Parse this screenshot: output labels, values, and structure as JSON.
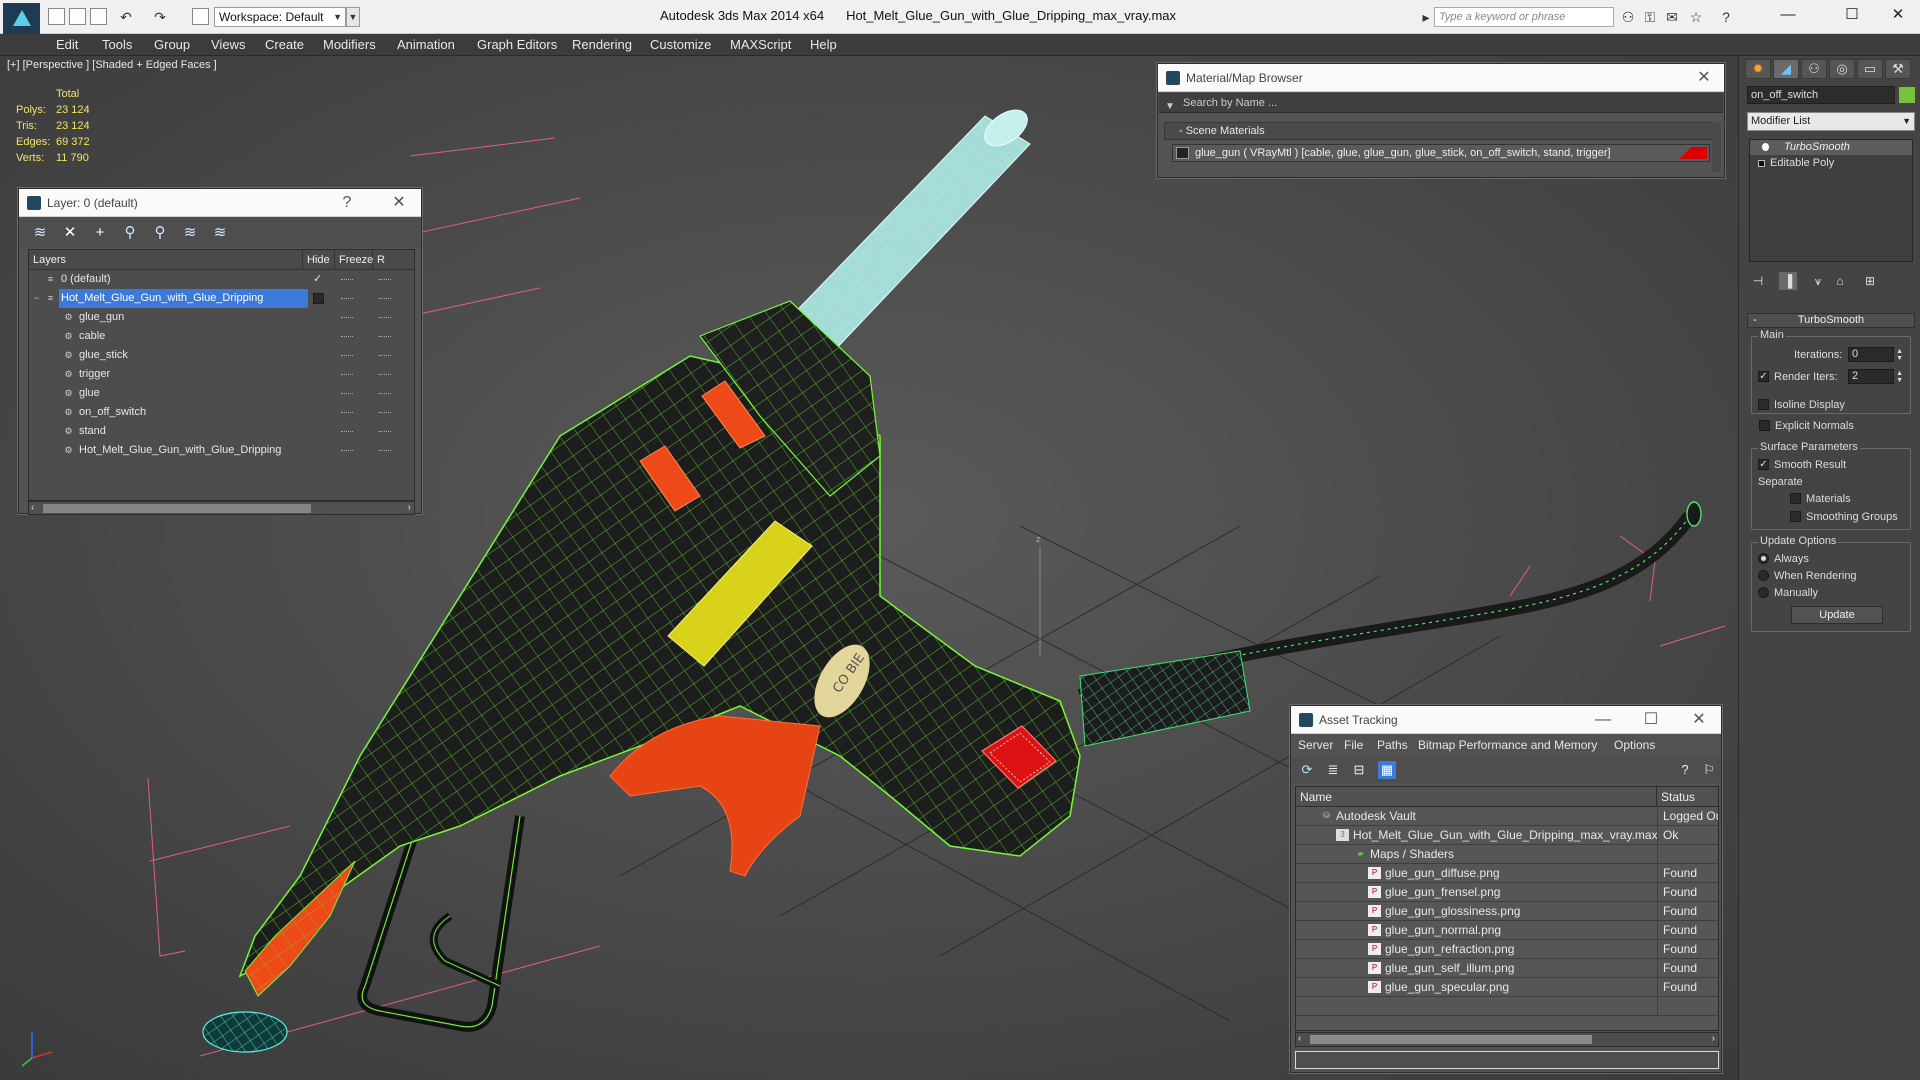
{
  "titlebar": {
    "workspace_label": "Workspace: Default",
    "app_name": "Autodesk 3ds Max  2014 x64",
    "file_name": "Hot_Melt_Glue_Gun_with_Glue_Dripping_max_vray.max",
    "search_placeholder": "Type a keyword or phrase"
  },
  "menu": [
    "Edit",
    "Tools",
    "Group",
    "Views",
    "Create",
    "Modifiers",
    "Animation",
    "Graph Editors",
    "Rendering",
    "Customize",
    "MAXScript",
    "Help"
  ],
  "viewport": {
    "label": "[+] [Perspective ] [Shaded + Edged Faces ]",
    "stats": {
      "header": "Total",
      "rows": [
        {
          "key": "Polys:",
          "value": "23 124"
        },
        {
          "key": "Tris:",
          "value": "23 124"
        },
        {
          "key": "Edges:",
          "value": "69 372"
        },
        {
          "key": "Verts:",
          "value": "11 790"
        }
      ]
    },
    "decal_text": "CO BIE"
  },
  "layers": {
    "title": "Layer: 0 (default)",
    "help": "?",
    "columns": {
      "name": "Layers",
      "hide": "Hide",
      "freeze": "Freeze",
      "render": "R"
    },
    "items": [
      {
        "name": "0 (default)",
        "check": "✓"
      },
      {
        "name": "Hot_Melt_Glue_Gun_with_Glue_Dripping"
      },
      {
        "name": "glue_gun"
      },
      {
        "name": "cable"
      },
      {
        "name": "glue_stick"
      },
      {
        "name": "trigger"
      },
      {
        "name": "glue"
      },
      {
        "name": "on_off_switch"
      },
      {
        "name": "stand"
      },
      {
        "name": "Hot_Melt_Glue_Gun_with_Glue_Dripping"
      }
    ]
  },
  "material_browser": {
    "title": "Material/Map Browser",
    "search_placeholder": "Search by Name ...",
    "section": "- Scene Materials",
    "material": "glue_gun  ( VRayMtl ) [cable, glue, glue_gun, glue_stick, on_off_switch, stand, trigger]"
  },
  "asset_tracking": {
    "title": "Asset Tracking",
    "menu": [
      "Server",
      "File",
      "Paths",
      "Bitmap Performance and Memory",
      "Options"
    ],
    "columns": {
      "name": "Name",
      "status": "Status"
    },
    "rows": [
      {
        "name": "Autodesk Vault",
        "status": "Logged Out"
      },
      {
        "name": "Hot_Melt_Glue_Gun_with_Glue_Dripping_max_vray.max",
        "status": "Ok"
      },
      {
        "name": "Maps / Shaders",
        "status": ""
      },
      {
        "name": "glue_gun_diffuse.png",
        "status": "Found"
      },
      {
        "name": "glue_gun_frensel.png",
        "status": "Found"
      },
      {
        "name": "glue_gun_glossiness.png",
        "status": "Found"
      },
      {
        "name": "glue_gun_normal.png",
        "status": "Found"
      },
      {
        "name": "glue_gun_refraction.png",
        "status": "Found"
      },
      {
        "name": "glue_gun_self_illum.png",
        "status": "Found"
      },
      {
        "name": "glue_gun_specular.png",
        "status": "Found"
      }
    ]
  },
  "command_panel": {
    "object_name": "on_off_switch",
    "object_color": "#77c43c",
    "modifier_list_label": "Modifier List",
    "stack": [
      "TurboSmooth",
      "Editable Poly"
    ],
    "rollout_title": "TurboSmooth",
    "main_group": "Main",
    "iterations_label": "Iterations:",
    "iterations_value": "0",
    "render_iters_label": "Render Iters:",
    "render_iters_value": "2",
    "isoline_label": "Isoline Display",
    "explicit_normals_label": "Explicit Normals",
    "surface_group": "Surface Parameters",
    "smooth_result_label": "Smooth Result",
    "separate_label": "Separate",
    "materials_label": "Materials",
    "smoothing_groups_label": "Smoothing Groups",
    "update_group": "Update Options",
    "always_label": "Always",
    "when_rendering_label": "When Rendering",
    "manually_label": "Manually",
    "update_button": "Update"
  }
}
